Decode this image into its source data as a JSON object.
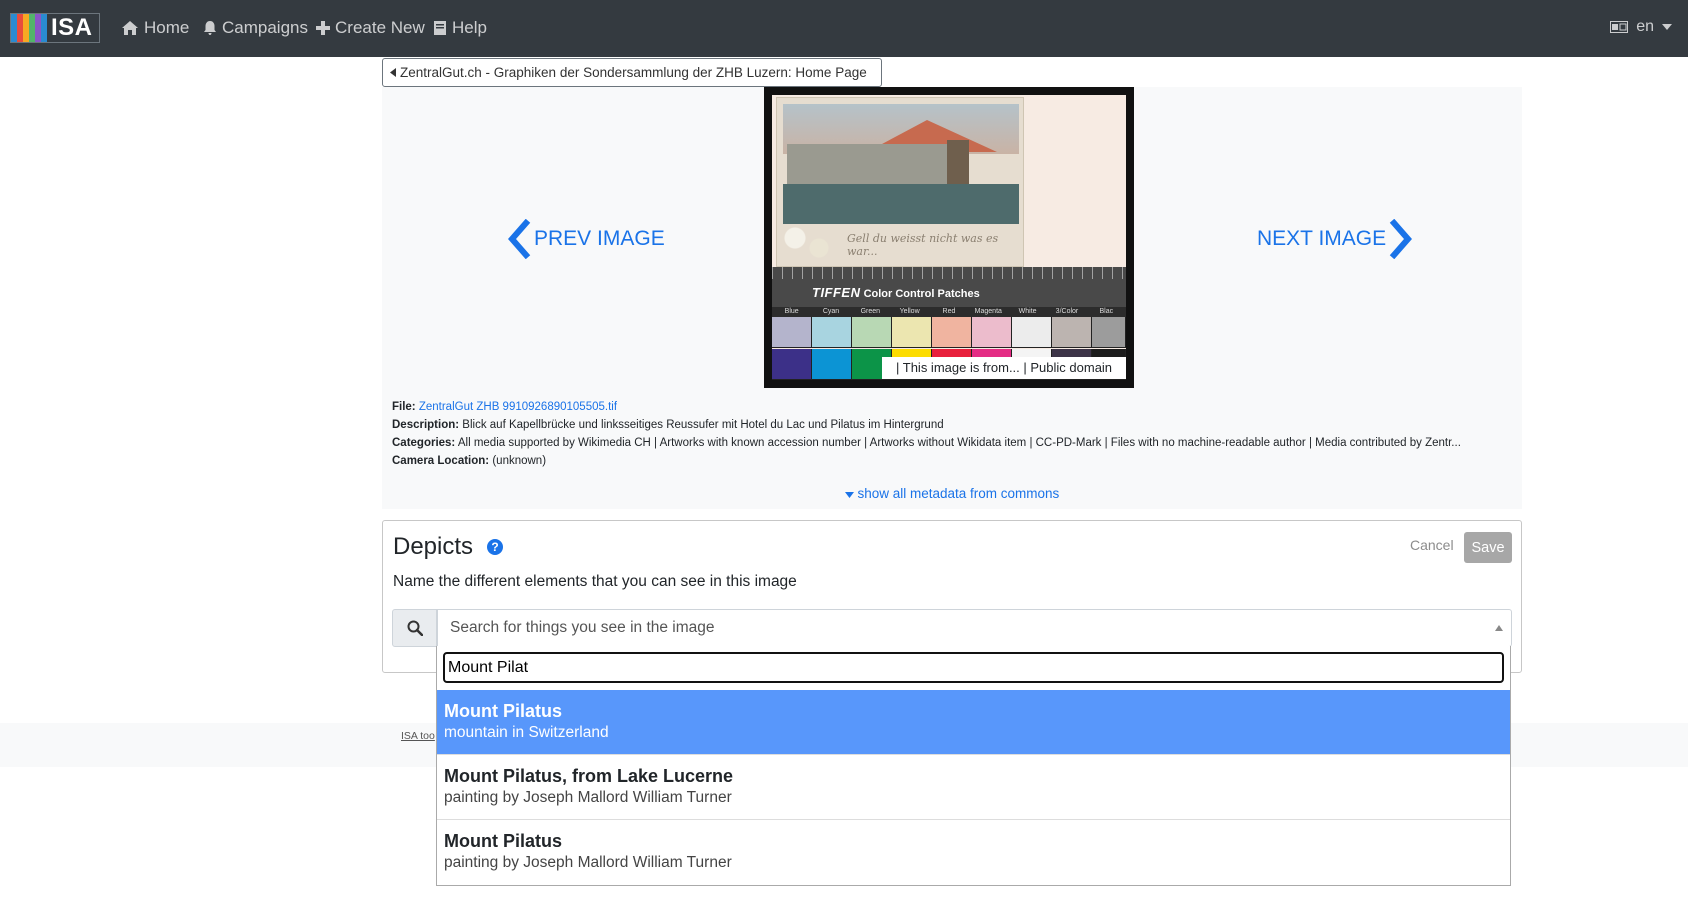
{
  "navbar": {
    "logo_text": "ISA",
    "items": [
      {
        "label": "Home",
        "icon": "home-icon"
      },
      {
        "label": "Campaigns",
        "icon": "bell-icon"
      },
      {
        "label": "Create New",
        "icon": "plus-icon"
      },
      {
        "label": "Help",
        "icon": "book-icon"
      }
    ],
    "language": "en"
  },
  "breadcrumb": "ZentralGut.ch - Graphiken der Sondersammlung der ZHB Luzern: Home Page",
  "viewer": {
    "prev_label": "PREV IMAGE",
    "next_label": "NEXT IMAGE",
    "caption": "| This image is from... | Public domain",
    "photo_text": {
      "brand": "TIFFEN",
      "chart_name": "Color Control Patches",
      "patch_labels": [
        "Blue",
        "Cyan",
        "Green",
        "Yellow",
        "Red",
        "Magenta",
        "White",
        "3/Color",
        "Blac"
      ]
    }
  },
  "metadata": {
    "file_label": "File:",
    "file_value": "ZentralGut ZHB 9910926890105505.tif",
    "description_label": "Description:",
    "description_value": "Blick auf Kapellbrücke und linksseitiges Reussufer mit Hotel du Lac und Pilatus im Hintergrund",
    "categories_label": "Categories:",
    "categories_value": "All media supported by Wikimedia CH | Artworks with known accession number | Artworks without Wikidata item | CC-PD-Mark | Files with no machine-readable author | Media contributed by Zentr...",
    "camera_label": "Camera Location:",
    "camera_value": "(unknown)",
    "show_all": "show all metadata from commons"
  },
  "depicts": {
    "title": "Depicts",
    "help": "?",
    "subtitle": "Name the different elements that you can see in this image",
    "cancel": "Cancel",
    "save": "Save",
    "search_placeholder": "Search for things you see in the image"
  },
  "footer": {
    "text": "ISA too"
  },
  "dropdown": {
    "query": "Mount Pilat",
    "results": [
      {
        "name": "Mount Pilatus",
        "description": "mountain in Switzerland",
        "highlighted": true
      },
      {
        "name": "Mount Pilatus, from Lake Lucerne",
        "description": "painting by Joseph Mallord William Turner",
        "highlighted": false
      },
      {
        "name": "Mount Pilatus",
        "description": "painting by Joseph Mallord William Turner",
        "highlighted": false
      }
    ]
  },
  "colors": {
    "navbar_bg": "#343a40",
    "link_blue": "#1a73e8",
    "highlight_blue": "#5897fb",
    "save_disabled": "#a7a7a7"
  }
}
